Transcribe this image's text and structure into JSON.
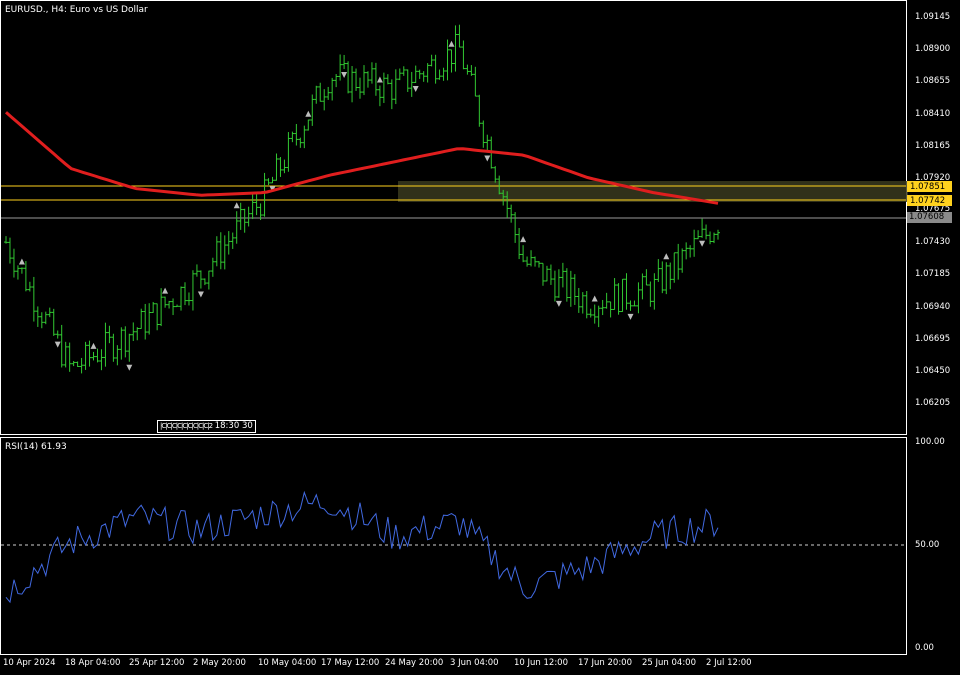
{
  "chart": {
    "symbol_title": "EURUSD., H4:  Euro vs US Dollar",
    "timer_text": "18:30",
    "timer_suffix": "30",
    "timer_ticks": "|C|C|C|C|C|C|C|C|C|2",
    "price_labels": [
      "1.09145",
      "1.08900",
      "1.08655",
      "1.08410",
      "1.08165",
      "1.07920",
      "1.07675",
      "1.07430",
      "1.07185",
      "1.06940",
      "1.06695",
      "1.06450",
      "1.06205"
    ],
    "price_tags": {
      "level_top": "1.07851",
      "level_mid": "1.07742",
      "current": "1.07608"
    },
    "date_labels": [
      "10 Apr 2024",
      "18 Apr 04:00",
      "25 Apr 12:00",
      "2 May 20:00",
      "10 May 04:00",
      "17 May 12:00",
      "24 May 20:00",
      "3 Jun 04:00",
      "10 Jun 12:00",
      "17 Jun 20:00",
      "25 Jun 04:00",
      "2 Jul 12:00"
    ]
  },
  "rsi": {
    "title": "RSI(14) 61.93",
    "levels": [
      "100.00",
      "50.00",
      "0.00"
    ]
  },
  "colors": {
    "background": "#000000",
    "candle": "#32c832",
    "moving_average": "#e01e1e",
    "rsi_line": "#4169e1",
    "level_line": "#ffd21e",
    "zone": "#3a3a1e"
  },
  "chart_data": [
    {
      "type": "line",
      "title": "EURUSD., H4:  Euro vs US Dollar",
      "ylim": [
        1.0606,
        1.092
      ],
      "x": [
        "10 Apr 2024",
        "18 Apr 04:00",
        "25 Apr 12:00",
        "2 May 20:00",
        "10 May 04:00",
        "17 May 12:00",
        "24 May 20:00",
        "3 Jun 04:00",
        "10 Jun 12:00",
        "17 Jun 20:00",
        "25 Jun 04:00",
        "2 Jul 12:00"
      ],
      "series": [
        {
          "name": "",
          "values": [
            1.0745,
            1.065,
            1.068,
            1.072,
            1.078,
            1.087,
            1.086,
            1.089,
            1.073,
            1.07,
            1.071,
            1.076
          ]
        },
        {
          "name": "",
          "values": [
            1.0842,
            1.08,
            1.0785,
            1.078,
            1.0782,
            1.0795,
            1.0805,
            1.0815,
            1.081,
            1.0793,
            1.0782,
            1.0774
          ]
        }
      ]
    },
    {
      "type": "line",
      "title": "RSI(14) 61.93",
      "ylim": [
        0,
        100
      ],
      "x": [
        "10 Apr 2024",
        "18 Apr 04:00",
        "25 Apr 12:00",
        "2 May 20:00",
        "10 May 04:00",
        "17 May 12:00",
        "24 May 20:00",
        "3 Jun 04:00",
        "10 Jun 12:00",
        "17 Jun 20:00",
        "25 Jun 04:00",
        "2 Jul 12:00"
      ],
      "series": [
        {
          "name": "",
          "values": [
            28,
            52,
            64,
            58,
            66,
            72,
            55,
            62,
            30,
            40,
            55,
            62
          ]
        }
      ]
    }
  ]
}
